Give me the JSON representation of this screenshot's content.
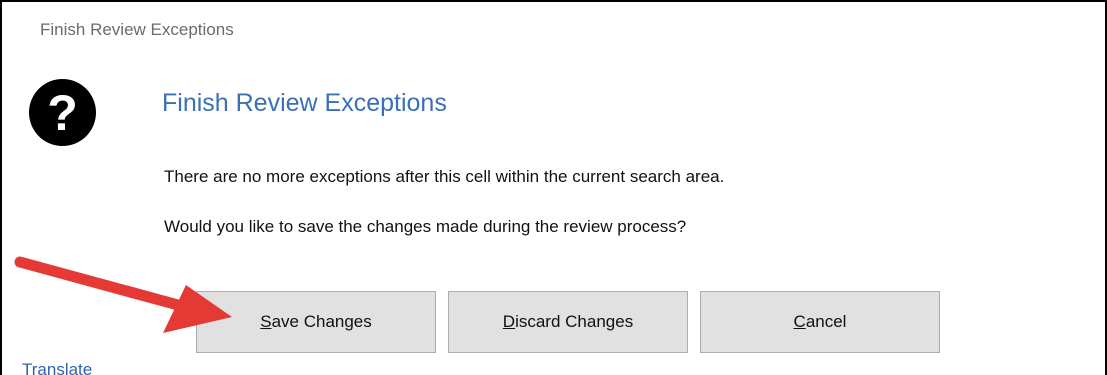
{
  "window": {
    "title": "Finish Review Exceptions"
  },
  "dialog": {
    "icon": "question-icon",
    "icon_glyph": "?",
    "heading": "Finish Review Exceptions",
    "message_line1": "There are no more exceptions after this cell within the current search area.",
    "message_line2": "Would you like to save the changes made during the review process?"
  },
  "buttons": {
    "save_label": "Save Changes",
    "discard_label": "Discard Changes",
    "cancel_label": "Cancel"
  },
  "footer": {
    "translate_label": "Translate"
  },
  "annotation": {
    "arrow_icon": "red-arrow-icon",
    "arrow_color": "#e53935"
  },
  "colors": {
    "heading": "#3b6fb6",
    "link": "#2e62b0",
    "button_bg": "#e1e1e1"
  }
}
